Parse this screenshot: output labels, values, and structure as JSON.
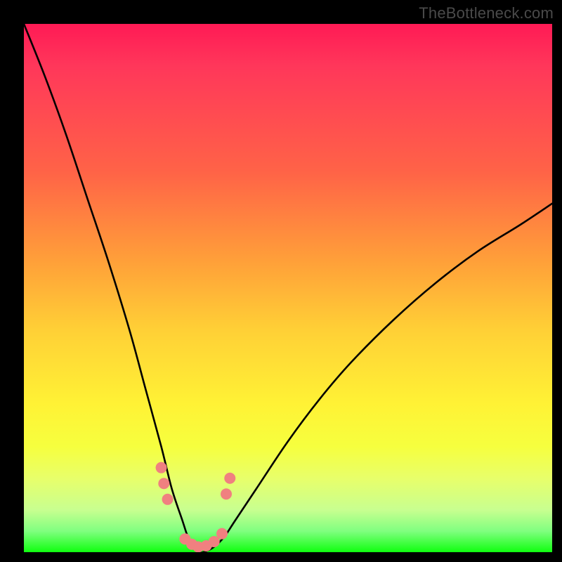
{
  "watermark": {
    "text": "TheBottleneck.com"
  },
  "chart_data": {
    "type": "line",
    "title": "",
    "xlabel": "",
    "ylabel": "",
    "xlim": [
      0,
      100
    ],
    "ylim": [
      0,
      100
    ],
    "background_gradient": {
      "direction": "vertical",
      "stops": [
        {
          "pos": 0,
          "color": "#ff1a55"
        },
        {
          "pos": 28,
          "color": "#ff6347"
        },
        {
          "pos": 58,
          "color": "#ffd036"
        },
        {
          "pos": 80,
          "color": "#f6ff3e"
        },
        {
          "pos": 96,
          "color": "#80ff80"
        },
        {
          "pos": 100,
          "color": "#10ff10"
        }
      ]
    },
    "series": [
      {
        "name": "bottleneck-curve",
        "color": "#000000",
        "x": [
          0,
          4,
          8,
          12,
          16,
          20,
          23,
          26,
          28,
          30,
          31,
          32,
          33,
          34,
          36,
          38,
          40,
          44,
          50,
          56,
          62,
          70,
          78,
          86,
          94,
          100
        ],
        "y": [
          100,
          90,
          79,
          67,
          55,
          42,
          31,
          20,
          12,
          6,
          3,
          1,
          0,
          0,
          1,
          3,
          6,
          12,
          21,
          29,
          36,
          44,
          51,
          57,
          62,
          66
        ]
      }
    ],
    "markers": {
      "name": "highlight-dots",
      "color": "#f08080",
      "radius": 8,
      "points": [
        {
          "x": 26.0,
          "y": 16
        },
        {
          "x": 26.5,
          "y": 13
        },
        {
          "x": 27.2,
          "y": 10
        },
        {
          "x": 30.5,
          "y": 2.5
        },
        {
          "x": 31.8,
          "y": 1.5
        },
        {
          "x": 33.0,
          "y": 1.0
        },
        {
          "x": 34.5,
          "y": 1.2
        },
        {
          "x": 36.0,
          "y": 2.0
        },
        {
          "x": 37.5,
          "y": 3.5
        },
        {
          "x": 38.3,
          "y": 11
        },
        {
          "x": 39.0,
          "y": 14
        }
      ]
    }
  }
}
